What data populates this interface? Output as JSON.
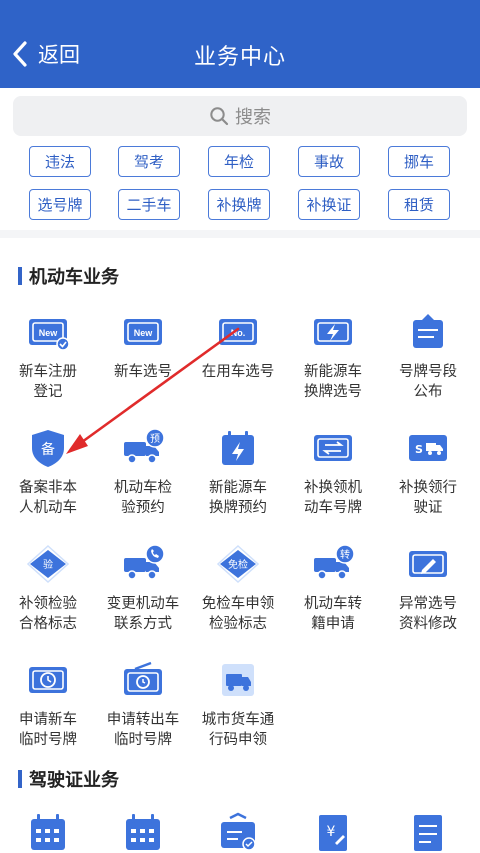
{
  "header": {
    "back_label": "返回",
    "title": "业务中心"
  },
  "search": {
    "label": "搜索"
  },
  "tags": [
    "违法",
    "驾考",
    "年检",
    "事故",
    "挪车",
    "选号牌",
    "二手车",
    "补换牌",
    "补换证",
    "租赁"
  ],
  "motor": {
    "title": "机动车业务",
    "items": [
      {
        "l1": "新车注册",
        "l2": "登记",
        "icon": "new-plate-check-icon"
      },
      {
        "l1": "新车选号",
        "l2": "",
        "icon": "new-plate-icon"
      },
      {
        "l1": "在用车选号",
        "l2": "",
        "icon": "number-plate-icon"
      },
      {
        "l1": "新能源车",
        "l2": "换牌选号",
        "icon": "ev-plate-icon"
      },
      {
        "l1": "号牌号段",
        "l2": "公布",
        "icon": "announcement-board-icon"
      },
      {
        "l1": "备案非本",
        "l2": "人机动车",
        "icon": "shield-record-icon"
      },
      {
        "l1": "机动车检",
        "l2": "验预约",
        "icon": "truck-reserve-icon"
      },
      {
        "l1": "新能源车",
        "l2": "换牌预约",
        "icon": "ev-calendar-icon"
      },
      {
        "l1": "补换领机",
        "l2": "动车号牌",
        "icon": "plate-exchange-icon"
      },
      {
        "l1": "补换领行",
        "l2": "驶证",
        "icon": "license-truck-icon"
      },
      {
        "l1": "补领检验",
        "l2": "合格标志",
        "icon": "inspection-badge-icon"
      },
      {
        "l1": "变更机动车",
        "l2": "联系方式",
        "icon": "truck-phone-icon"
      },
      {
        "l1": "免检车申领",
        "l2": "检验标志",
        "icon": "exempt-badge-icon"
      },
      {
        "l1": "机动车转",
        "l2": "籍申请",
        "icon": "truck-transfer-icon"
      },
      {
        "l1": "异常选号",
        "l2": "资料修改",
        "icon": "edit-plate-icon"
      },
      {
        "l1": "申请新车",
        "l2": "临时号牌",
        "icon": "temp-plate-clock-icon"
      },
      {
        "l1": "申请转出车",
        "l2": "临时号牌",
        "icon": "temp-plate-radio-icon"
      },
      {
        "l1": "城市货车通",
        "l2": "行码申领",
        "icon": "city-truck-icon"
      }
    ]
  },
  "driver": {
    "title": "驾驶证业务",
    "icons": [
      "calendar-icon",
      "calendar-icon",
      "checklist-badge-icon",
      "fee-document-icon",
      "document-icon"
    ]
  },
  "colors": {
    "brand": "#2f63c8",
    "icon_blue": "#3d73dc",
    "annotation_arrow": "#e02b2b"
  }
}
